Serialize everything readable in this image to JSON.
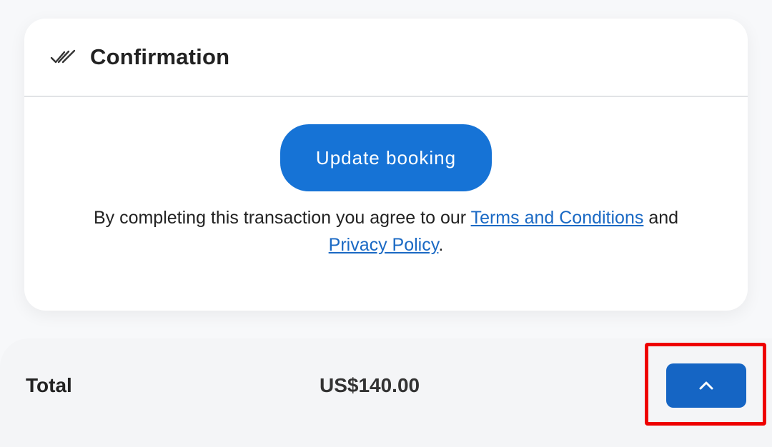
{
  "confirmation": {
    "title": "Confirmation",
    "header_icon": "double-check-icon",
    "update_button_label": "Update booking",
    "terms": {
      "prefix": "By completing this transaction you agree to our ",
      "terms_link": "Terms and Conditions",
      "middle": " and ",
      "privacy_link": "Privacy Policy",
      "suffix": "."
    }
  },
  "summary": {
    "total_label": "Total",
    "total_value": "US$140.00",
    "expand_icon": "chevron-up-icon"
  },
  "colors": {
    "primary_button": "#1673d6",
    "expand_button": "#1565c4",
    "link": "#1a69c4",
    "highlight": "#ee0000"
  }
}
